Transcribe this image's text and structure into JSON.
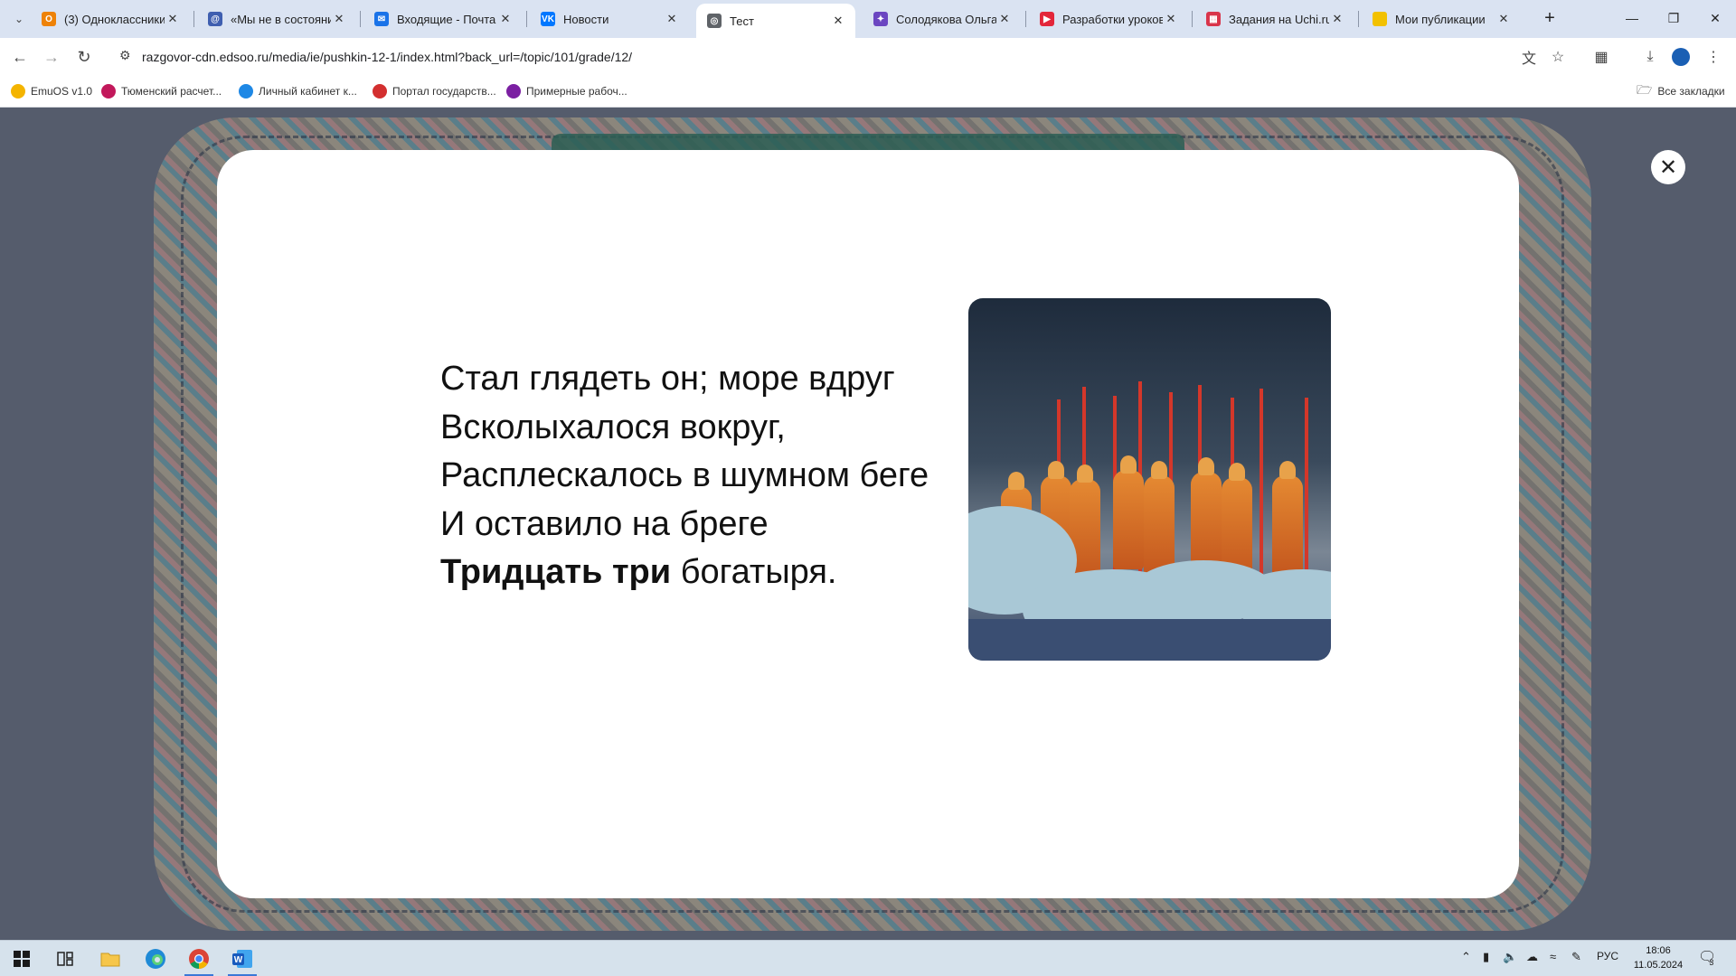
{
  "browser": {
    "tabs": [
      {
        "title": "(3) Одноклассники",
        "icon": "odnoklassniki-icon",
        "color": "#ee8208",
        "glyph": "О"
      },
      {
        "title": "«Мы не в состоянии",
        "icon": "circle-at-icon",
        "color": "#3f5fb0",
        "glyph": "@"
      },
      {
        "title": "Входящие - Почта М",
        "icon": "mail-icon",
        "color": "#1a73e8",
        "glyph": "✉"
      },
      {
        "title": "Новости",
        "icon": "vk-icon",
        "color": "#0077ff",
        "glyph": "VK"
      },
      {
        "title": "Тест",
        "icon": "globe-icon",
        "color": "#5f6368",
        "glyph": "◎",
        "active": true
      },
      {
        "title": "Солодякова Ольга",
        "icon": "infourok-icon",
        "color": "#6b46c1",
        "glyph": "✦"
      },
      {
        "title": "Разработки уроков",
        "icon": "pptx-icon",
        "color": "#e3263a",
        "glyph": "▶"
      },
      {
        "title": "Задания на Uchi.ru",
        "icon": "uchi-icon",
        "color": "#d9344a",
        "glyph": "▦"
      },
      {
        "title": "Мои публикации",
        "icon": "zen-icon",
        "color": "#f2c100",
        "glyph": ""
      }
    ],
    "new_tab_label": "+",
    "url": "razgovor-cdn.edsoo.ru/media/ie/pushkin-12-1/index.html?back_url=/topic/101/grade/12/",
    "bookmarks": [
      {
        "label": "EmuOS v1.0",
        "color": "#f4b400"
      },
      {
        "label": "Тюменский расчет...",
        "color": "#c2185b"
      },
      {
        "label": "Личный кабинет к...",
        "color": "#1e88e5"
      },
      {
        "label": "Портал государств...",
        "color": "#d32f2f"
      },
      {
        "label": "Примерные рабоч...",
        "color": "#7b1fa2"
      }
    ],
    "all_bookmarks_label": "Все закладки"
  },
  "poem": {
    "line1": "Стал глядеть он; море вдруг",
    "line2": "Всколыхалося вокруг,",
    "line3": "Расплескалось в шумном беге",
    "line4": "И оставило на бреге",
    "line5_bold": "Тридцать три",
    "line5_rest": " богатыря."
  },
  "taskbar": {
    "language": "РУС",
    "time": "18:06",
    "date": "11.05.2024",
    "notifications_count": "3"
  }
}
